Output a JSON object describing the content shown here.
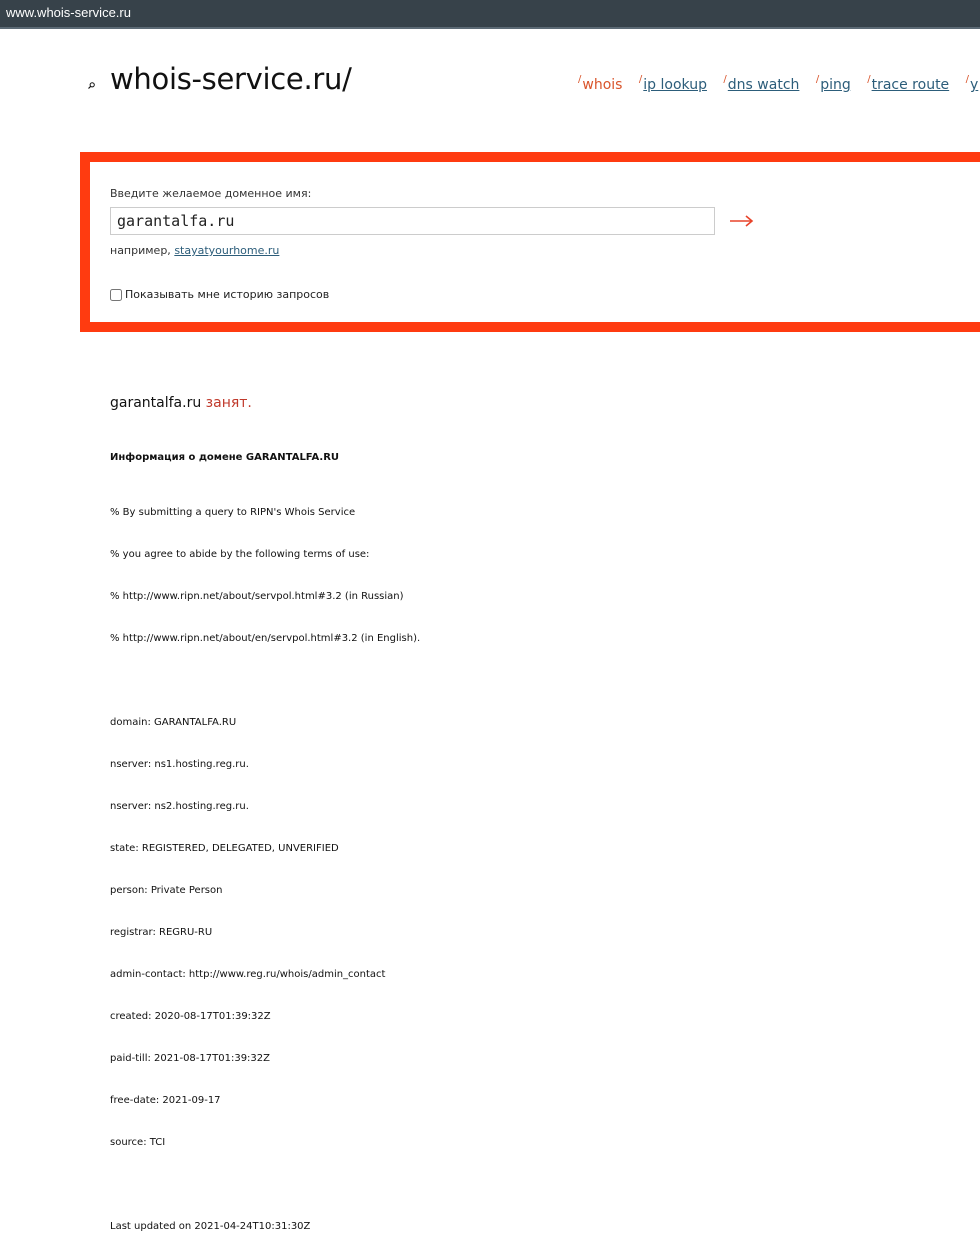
{
  "browser": {
    "address": "www.whois-service.ru"
  },
  "header": {
    "site_title": "whois-service.ru/",
    "nav": [
      {
        "label": "whois",
        "active": true
      },
      {
        "label": "ip lookup",
        "active": false
      },
      {
        "label": "dns watch",
        "active": false
      },
      {
        "label": "ping",
        "active": false
      },
      {
        "label": "trace route",
        "active": false
      },
      {
        "label": "y",
        "active": false
      }
    ]
  },
  "form": {
    "label": "Введите желаемое доменное имя:",
    "input_value": "garantalfa.ru",
    "example_prefix": "например,",
    "example_link": "stayatyourhome.ru",
    "history_label": "Показывать мне историю запросов",
    "history_checked": false
  },
  "result": {
    "domain": "garantalfa.ru",
    "status": "занят."
  },
  "whois": {
    "heading": "Информация о домене GARANTALFA.RU",
    "lines": [
      "% By submitting a query to RIPN's Whois Service",
      "% you agree to abide by the following terms of use:",
      "% http://www.ripn.net/about/servpol.html#3.2 (in Russian)",
      "% http://www.ripn.net/about/en/servpol.html#3.2 (in English).",
      "",
      "domain: GARANTALFA.RU",
      "nserver: ns1.hosting.reg.ru.",
      "nserver: ns2.hosting.reg.ru.",
      "state: REGISTERED, DELEGATED, UNVERIFIED",
      "person: Private Person",
      "registrar: REGRU-RU",
      "admin-contact: http://www.reg.ru/whois/admin_contact",
      "created: 2020-08-17T01:39:32Z",
      "paid-till: 2021-08-17T01:39:32Z",
      "free-date: 2021-09-17",
      "source: TCI",
      "",
      "Last updated on 2021-04-24T10:31:30Z"
    ]
  },
  "colors": {
    "accent": "#d9542b",
    "frame": "#ff3b10",
    "link": "#2c5d7a",
    "addressbar": "#37424a"
  }
}
